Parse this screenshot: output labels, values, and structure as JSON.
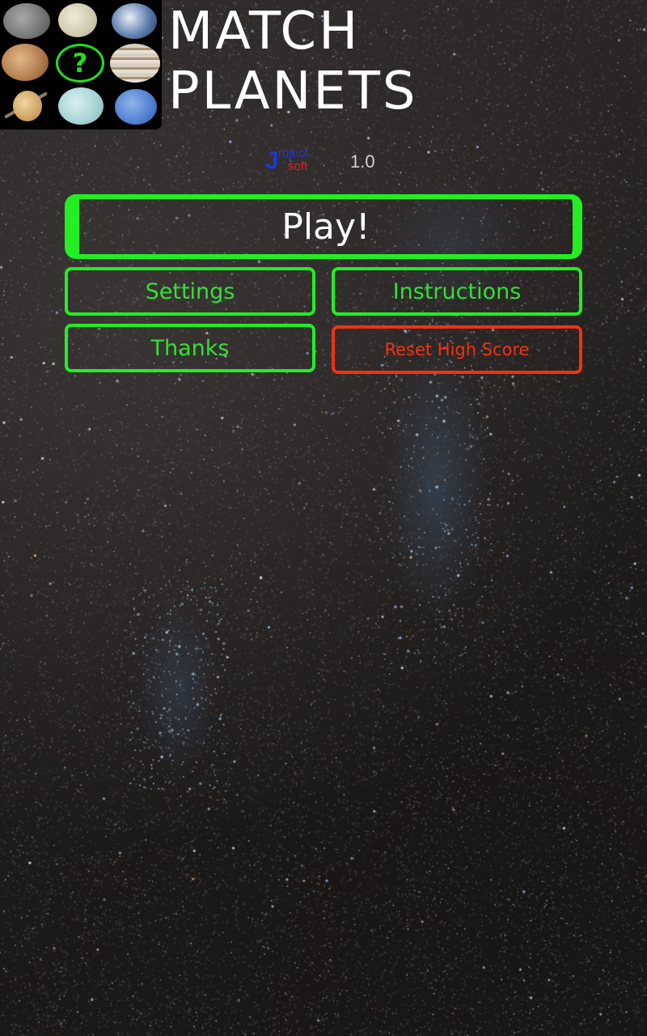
{
  "app": {
    "title_line1": "MATCH",
    "title_line2": "PLANETS",
    "logo_icons": [
      "mercury",
      "venus",
      "earth",
      "mars",
      "question-mark",
      "jupiter",
      "saturn",
      "uranus",
      "neptune"
    ],
    "logo_question": "?"
  },
  "brand": {
    "j": "J",
    "project": "roject",
    "soft": "soft",
    "version": "1.0",
    "colors": {
      "blue": "#1a3ad8",
      "red": "#e02020"
    }
  },
  "menu": {
    "play": "Play!",
    "settings": "Settings",
    "instructions": "Instructions",
    "thanks": "Thanks",
    "reset_high_score": "Reset High Score"
  },
  "colors": {
    "accent_green": "#22ee22",
    "danger_red": "#ee3311",
    "text_white": "#ffffff"
  }
}
